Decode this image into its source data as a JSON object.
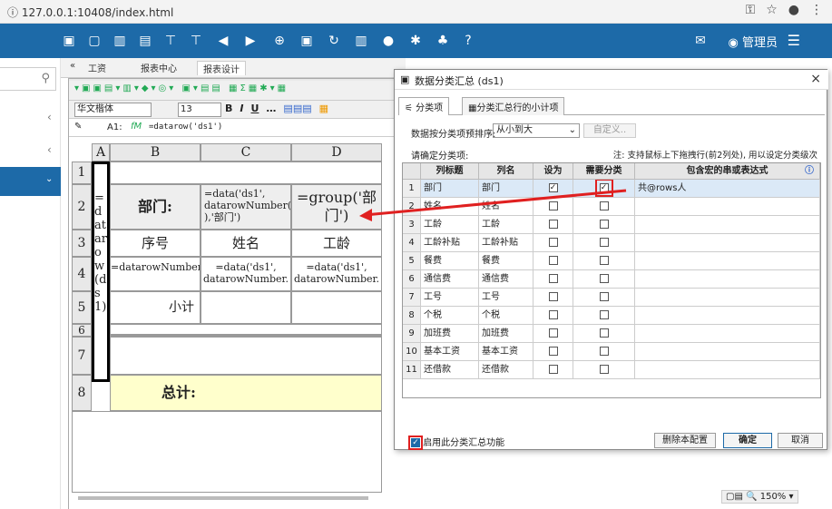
{
  "browser": {
    "url": "127.0.0.1:10408/index.html"
  },
  "header": {
    "admin_label": "管理员"
  },
  "tabs": [
    {
      "label": "«"
    },
    {
      "label": "工资"
    },
    {
      "label": "报表中心"
    },
    {
      "label": "报表设计"
    }
  ],
  "toolbar": {
    "font_name": "华文楷体",
    "font_size": "13",
    "bold": "B",
    "italic": "I",
    "underline": "U"
  },
  "formula_bar": {
    "cell_ref": "A1:",
    "fx": "fM",
    "formula": "=datarow('ds1')"
  },
  "grid": {
    "columns": [
      "A",
      "B",
      "C",
      "D"
    ],
    "rows": [
      "1",
      "2",
      "3",
      "4",
      "5",
      "6",
      "7",
      "8"
    ],
    "cells": {
      "a_merged": "=datarow(ds1)",
      "b2": "部门:",
      "c2": "=data('ds1', datarowNumber( ),'部门')",
      "d2": "=group('部门')",
      "b3": "序号",
      "c3": "姓名",
      "d3": "工龄",
      "b4": "=datarowNumber()",
      "c4": "=data('ds1', datarowNumber.",
      "d4": "=data('ds1', datarowNumber.",
      "b5": "小计",
      "b8": "总计:"
    }
  },
  "dialog": {
    "title": "数据分类汇总 (ds1)",
    "tabs": [
      "分类项",
      "分类汇总行的小计项"
    ],
    "sort_label": "数据按分类项预排序:",
    "sort_value": "从小到大",
    "custom_button": "自定义..",
    "confirm_label": "请确定分类项:",
    "note": "注: 支持鼠标上下拖拽行(前2列处), 用以设定分类级次",
    "table_headers": [
      "列标题",
      "列名",
      "设为",
      "需要分类",
      "包含宏的串或表达式"
    ],
    "rows": [
      {
        "num": "1",
        "title": "部门",
        "name": "部门",
        "set": true,
        "need": true,
        "expr": "共@rows人"
      },
      {
        "num": "2",
        "title": "姓名",
        "name": "姓名",
        "set": false,
        "need": false,
        "expr": ""
      },
      {
        "num": "3",
        "title": "工龄",
        "name": "工龄",
        "set": false,
        "need": false,
        "expr": ""
      },
      {
        "num": "4",
        "title": "工龄补贴",
        "name": "工龄补贴",
        "set": false,
        "need": false,
        "expr": ""
      },
      {
        "num": "5",
        "title": "餐费",
        "name": "餐费",
        "set": false,
        "need": false,
        "expr": ""
      },
      {
        "num": "6",
        "title": "通信费",
        "name": "通信费",
        "set": false,
        "need": false,
        "expr": ""
      },
      {
        "num": "7",
        "title": "工号",
        "name": "工号",
        "set": false,
        "need": false,
        "expr": ""
      },
      {
        "num": "8",
        "title": "个税",
        "name": "个税",
        "set": false,
        "need": false,
        "expr": ""
      },
      {
        "num": "9",
        "title": "加班费",
        "name": "加班费",
        "set": false,
        "need": false,
        "expr": ""
      },
      {
        "num": "10",
        "title": "基本工资",
        "name": "基本工资",
        "set": false,
        "need": false,
        "expr": ""
      },
      {
        "num": "11",
        "title": "还借款",
        "name": "还借款",
        "set": false,
        "need": false,
        "expr": ""
      }
    ],
    "enable_label": "启用此分类汇总功能",
    "delete_button": "删除本配置",
    "ok_button": "确定",
    "cancel_button": "取消"
  },
  "statusbar": {
    "zoom": "150%"
  },
  "colors": {
    "header_bg": "#1d6aa8",
    "highlight": "#e02020",
    "total_bg": "#ffffcc"
  }
}
